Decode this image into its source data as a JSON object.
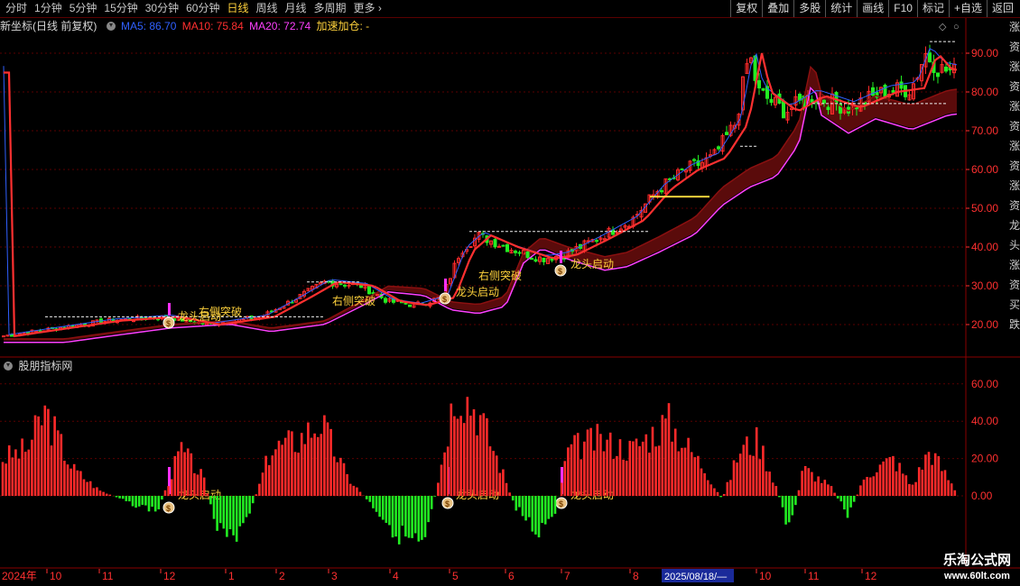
{
  "toolbar": {
    "periods": [
      "分时",
      "1分钟",
      "5分钟",
      "15分钟",
      "30分钟",
      "60分钟",
      "日线",
      "周线",
      "月线",
      "多周期",
      "更多"
    ],
    "active_period": "日线",
    "right_buttons": [
      "复权",
      "叠加",
      "多股",
      "统计",
      "画线",
      "F10",
      "标记",
      "+自选",
      "返回"
    ]
  },
  "info": {
    "title": "新坐标(日线 前复权)",
    "ma5_label": "MA5: 86.70",
    "ma10_label": "MA10: 75.84",
    "ma20_label": "MA20: 72.74",
    "extra_label": "加速加仓: -"
  },
  "colors": {
    "up": "#ff2a2a",
    "down": "#22ee22",
    "ma5": "#3060ff",
    "ma10": "#ff3030",
    "ma20": "#ff40ff",
    "yellow": "#ffd23c",
    "grid": "#5a0000"
  },
  "main_axis": {
    "ticks": [
      "90.00",
      "80.00",
      "70.00",
      "60.00",
      "50.00",
      "40.00",
      "30.00",
      "20.00"
    ]
  },
  "annotations": {
    "right_break": "右侧突破",
    "dragon_start": "龙头启动"
  },
  "indicator": {
    "title": "股朋指标网",
    "ticks": [
      "60.00",
      "40.00",
      "20.00",
      "0.00"
    ],
    "label": "龙头启动"
  },
  "date_axis": {
    "year_label": "2024年",
    "months": [
      "10",
      "11",
      "12",
      "1",
      "2",
      "3",
      "4",
      "5",
      "6",
      "7",
      "8",
      "10",
      "11",
      "12"
    ],
    "cursor_date": "2025/08/18/—"
  },
  "watermark": {
    "line1": "乐淘公式网",
    "line2": "www.60lt.com"
  },
  "sidebar": {
    "right_tags": "涨资涨资涨资涨资涨资龙头涨资买跌"
  }
}
